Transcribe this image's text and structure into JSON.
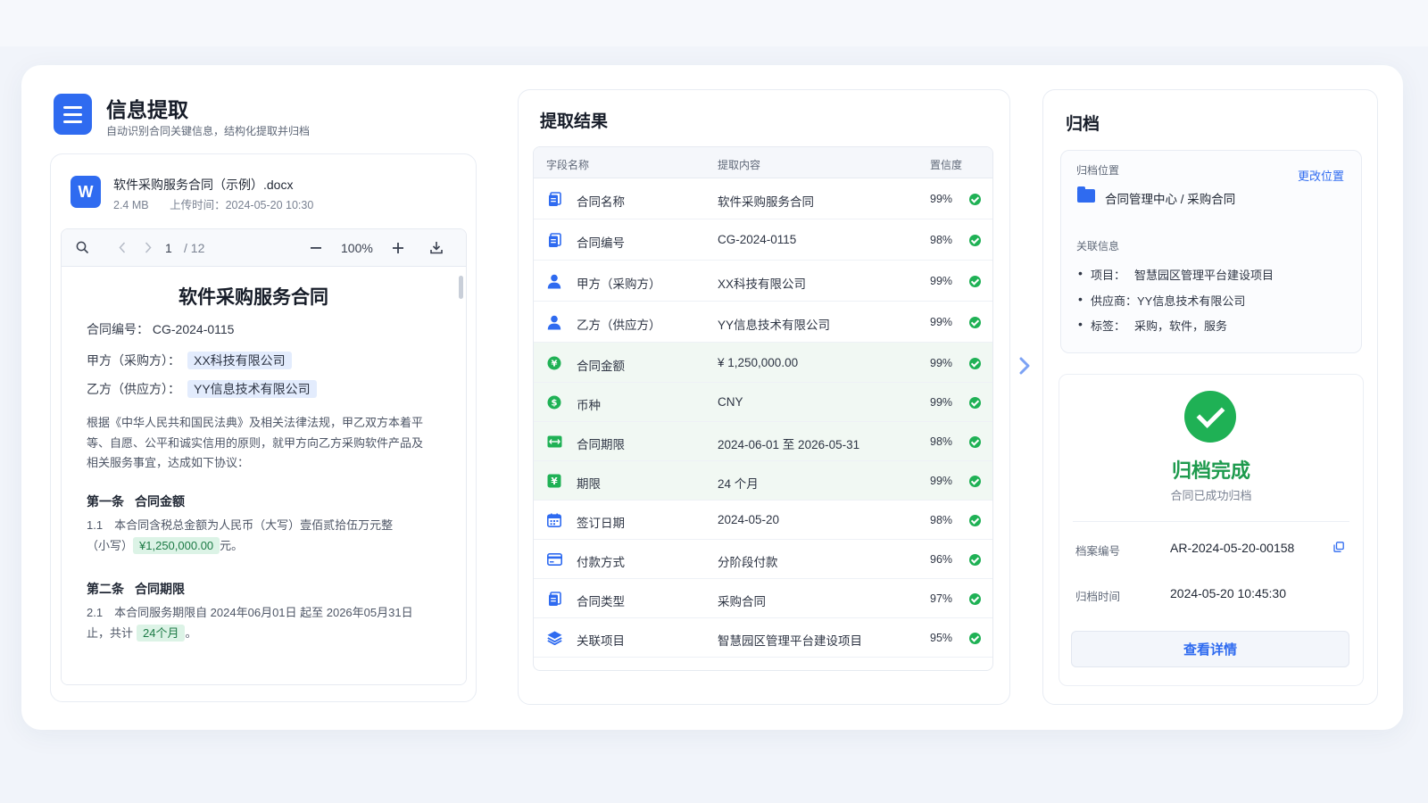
{
  "app": {
    "title": "信息提取",
    "subtitle": "自动识别合同关键信息，结构化提取并归档"
  },
  "file": {
    "icon_letter": "W",
    "name": "软件采购服务合同（示例）.docx",
    "size": "2.4 MB",
    "uploaded": "上传时间：2024-05-20 10:30"
  },
  "viewer": {
    "page_current": "1",
    "page_total": "/ 12",
    "zoom": "100%",
    "icons": [
      "zoom-icon",
      "prev-page-icon",
      "next-page-icon",
      "zoom-out-icon",
      "zoom-in-icon",
      "download-icon"
    ]
  },
  "document": {
    "title": "软件采购服务合同",
    "contract_no_label": "合同编号：",
    "contract_no": "CG-2024-0115",
    "party_a_label": "甲方（采购方）：",
    "party_a": "XX科技有限公司",
    "party_b_label": "乙方（供应方）：",
    "party_b": "YY信息技术有限公司",
    "intro": "根据《中华人民共和国民法典》及相关法律法规，甲乙双方本着平等、自愿、公平和诚实信用的原则，就甲方向乙方采购软件产品及相关服务事宜，达成如下协议：",
    "s1_no": "第一条",
    "s1_title": "合同金额",
    "s1_text_a": "1.1　本合同含税总金额为人民币（大写）壹佰贰拾伍万元整",
    "s1_text_b": "（小写）",
    "s1_amount": "¥1,250,000.00",
    "s1_text_c": "元。",
    "s2_no": "第二条",
    "s2_title": "合同期限",
    "s2_text_a": "2.1　本合同服务期限自 2024年06月01日 起至 2026年05月31日",
    "s2_text_b": "止，共计",
    "s2_term": "24个月",
    "s2_text_c": "。"
  },
  "results": {
    "title": "提取结果",
    "columns": [
      "字段名称",
      "提取内容",
      "置信度"
    ],
    "rows": [
      {
        "icon": "document-icon",
        "field": "合同名称",
        "value": "软件采购服务合同",
        "confidence": "99%",
        "highlight": false
      },
      {
        "icon": "document-icon",
        "field": "合同编号",
        "value": "CG-2024-0115",
        "confidence": "98%",
        "highlight": false
      },
      {
        "icon": "person-icon",
        "field": "甲方（采购方）",
        "value": "XX科技有限公司",
        "confidence": "99%",
        "highlight": false
      },
      {
        "icon": "person-icon",
        "field": "乙方（供应方）",
        "value": "YY信息技术有限公司",
        "confidence": "99%",
        "highlight": false
      },
      {
        "icon": "yen-icon",
        "field": "合同金额",
        "value": "¥  1,250,000.00",
        "confidence": "99%",
        "highlight": true
      },
      {
        "icon": "dollar-icon",
        "field": "币种",
        "value": "CNY",
        "confidence": "99%",
        "highlight": true
      },
      {
        "icon": "range-icon",
        "field": "合同期限",
        "value": "2024-06-01 至 2026-05-31",
        "confidence": "98%",
        "highlight": true
      },
      {
        "icon": "yen-square-icon",
        "field": "期限",
        "value": "24 个月",
        "confidence": "99%",
        "highlight": true
      },
      {
        "icon": "calendar-icon",
        "field": "签订日期",
        "value": "2024-05-20",
        "confidence": "98%",
        "highlight": false
      },
      {
        "icon": "card-icon",
        "field": "付款方式",
        "value": "分阶段付款",
        "confidence": "96%",
        "highlight": false
      },
      {
        "icon": "document-icon",
        "field": "合同类型",
        "value": "采购合同",
        "confidence": "97%",
        "highlight": false
      },
      {
        "icon": "layers-icon",
        "field": "关联项目",
        "value": "智慧园区管理平台建设项目",
        "confidence": "95%",
        "highlight": false
      }
    ]
  },
  "archive": {
    "title": "归档",
    "location_label": "归档位置",
    "change_location": "更改位置",
    "location_path": "合同管理中心 / 采购合同",
    "related_label": "关联信息",
    "related": [
      {
        "key": "项目：",
        "value": "智慧园区管理平台建设项目"
      },
      {
        "key": "供应商：",
        "value": "YY信息技术有限公司"
      },
      {
        "key": "标签：",
        "value": "采购，软件，服务"
      }
    ],
    "done_title": "归档完成",
    "done_subtitle": "合同已成功归档",
    "archive_no_label": "档案编号",
    "archive_no": "AR-2024-05-20-00158",
    "archive_time_label": "归档时间",
    "archive_time": "2024-05-20 10:45:30",
    "detail_button": "查看详情"
  },
  "colors": {
    "primary": "#2f6bf0",
    "success": "#1fb155",
    "success_text": "#1d9a4d",
    "highlight_row": "#f1f8f3",
    "highlight_blue": "#e3ecfd",
    "highlight_green": "#dcf3e6"
  }
}
